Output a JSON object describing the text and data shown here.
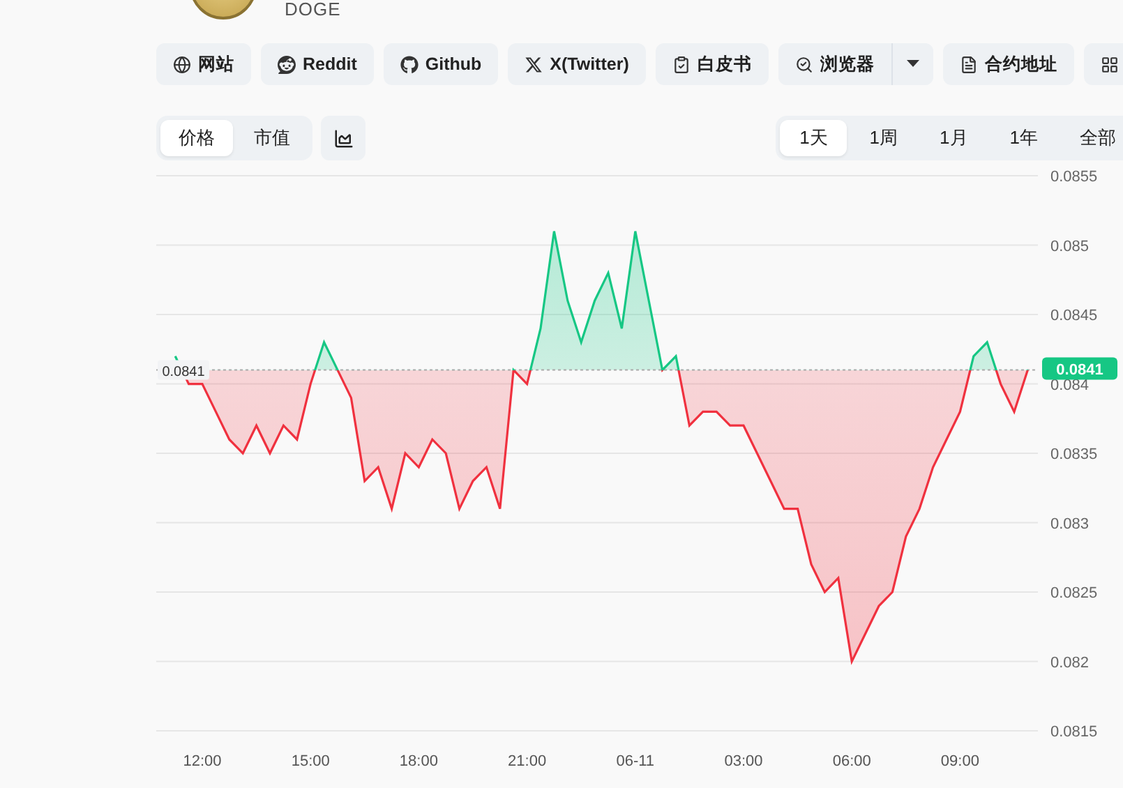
{
  "coin": {
    "symbol": "DOGE"
  },
  "links": [
    {
      "kind": "globe",
      "label": "网站"
    },
    {
      "kind": "reddit",
      "label": "Reddit"
    },
    {
      "kind": "github",
      "label": "Github"
    },
    {
      "kind": "x",
      "label": "X(Twitter)"
    },
    {
      "kind": "whitepaper",
      "label": "白皮书"
    },
    {
      "kind": "explorer",
      "label": "浏览器",
      "has_menu": true
    },
    {
      "kind": "contract",
      "label": "合约地址"
    },
    {
      "kind": "grid"
    }
  ],
  "metric_tabs": [
    {
      "label": "价格",
      "selected": true
    },
    {
      "label": "市值",
      "selected": false
    }
  ],
  "ranges": [
    {
      "label": "1天",
      "selected": true
    },
    {
      "label": "1周",
      "selected": false
    },
    {
      "label": "1月",
      "selected": false
    },
    {
      "label": "1年",
      "selected": false
    },
    {
      "label": "全部",
      "selected": false
    }
  ],
  "chart": {
    "last_price": "0.0841",
    "chart_data": {
      "type": "area",
      "grid": true,
      "ref_lines": [
        {
          "axis": "y",
          "value": 0.0841,
          "label": "0.0841"
        }
      ],
      "categories": [
        null,
        null,
        "12:00",
        null,
        null,
        null,
        null,
        null,
        null,
        null,
        "15:00",
        null,
        null,
        null,
        null,
        null,
        null,
        null,
        "18:00",
        null,
        null,
        null,
        null,
        null,
        null,
        null,
        "21:00",
        null,
        null,
        null,
        null,
        null,
        null,
        null,
        "06-11",
        null,
        null,
        null,
        null,
        null,
        null,
        null,
        "03:00",
        null,
        null,
        null,
        null,
        null,
        null,
        null,
        "06:00",
        null,
        null,
        null,
        null,
        null,
        null,
        null,
        "09:00",
        null,
        null,
        null,
        null,
        null
      ],
      "series": [
        {
          "values": [
            0.0842,
            0.084,
            0.084,
            0.0838,
            0.0836,
            0.0835,
            0.0837,
            0.0835,
            0.0837,
            0.0836,
            0.084,
            0.0843,
            0.0841,
            0.0839,
            0.0833,
            0.0834,
            0.0831,
            0.0835,
            0.0834,
            0.0836,
            0.0835,
            0.0831,
            0.0833,
            0.0834,
            0.0831,
            0.0841,
            0.084,
            0.0844,
            0.0851,
            0.0846,
            0.0843,
            0.0846,
            0.0848,
            0.0844,
            0.0851,
            0.0846,
            0.0841,
            0.0842,
            0.0837,
            0.0838,
            0.0838,
            0.0837,
            0.0837,
            0.0835,
            0.0833,
            0.0831,
            0.0831,
            0.0827,
            0.0825,
            0.0826,
            0.082,
            0.0822,
            0.0824,
            0.0825,
            0.0829,
            0.0831,
            0.0834,
            0.0836,
            0.0838,
            0.0842,
            0.0843,
            0.084,
            0.0838,
            0.0841
          ]
        }
      ],
      "ylim": [
        0.0815,
        0.0855
      ],
      "yticks": [
        0.0855,
        0.085,
        0.0845,
        0.084,
        0.0835,
        0.083,
        0.0825,
        0.082,
        0.0815
      ]
    }
  }
}
